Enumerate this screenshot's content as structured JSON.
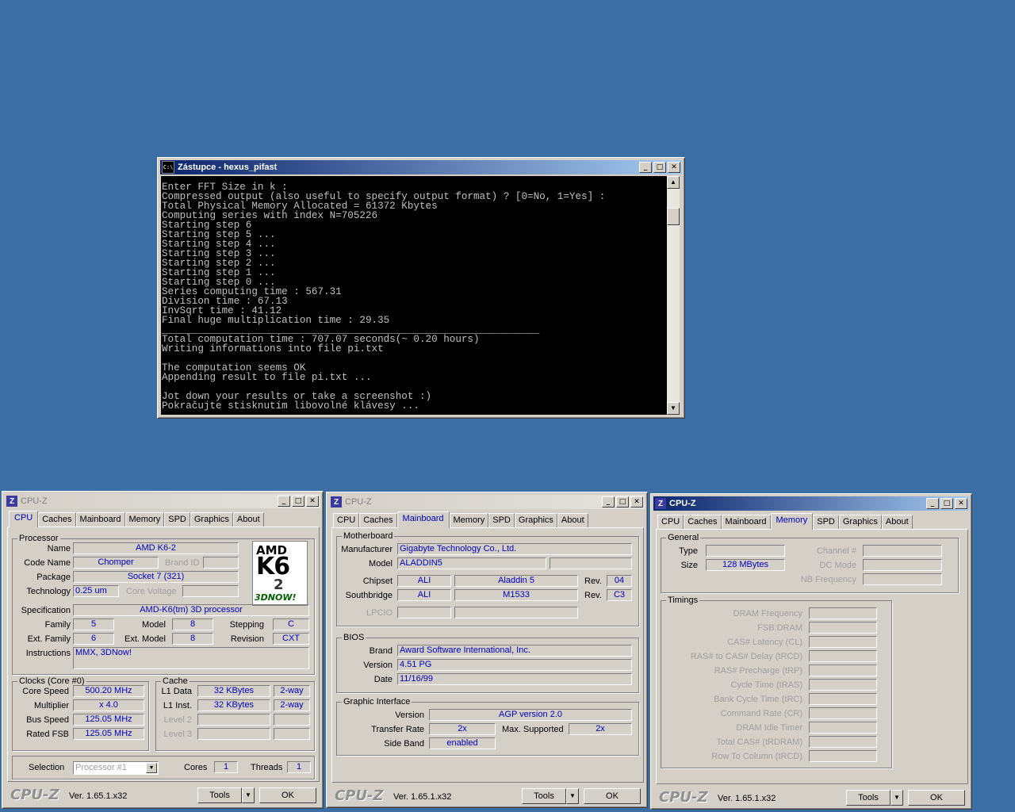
{
  "console_window": {
    "title": "Zástupce - hexus_pifast",
    "icon": "console-icon",
    "lines": [
      "Enter FFT Size in k :",
      "Compressed output (also useful to specify output format) ? [0=No, 1=Yes] :",
      "Total Physical Memory Allocated = 61372 Kbytes",
      "Computing series with index N=705226",
      "Starting step 6",
      "Starting step 5 ...",
      "Starting step 4 ...",
      "Starting step 3 ...",
      "Starting step 2 ...",
      "Starting step 1 ...",
      "Starting step 0 ...",
      "Series computing time : 567.31",
      "Division time : 67.13",
      "InvSqrt time : 41.12",
      "Final huge multiplication time : 29.35",
      "_______________________________________________________________",
      "Total computation time : 707.07 seconds(~ 0.20 hours)",
      "Writing informations into file pi.txt",
      "",
      "The computation seems OK",
      "Appending result to file pi.txt ...",
      "",
      "Jot down your results or take a screenshot :)",
      "Pokračujte stisknutím libovolné klávesy ..."
    ]
  },
  "cpuz_common": {
    "title": "CPU-Z",
    "icon": "cpuz-icon",
    "tabs": [
      "CPU",
      "Caches",
      "Mainboard",
      "Memory",
      "SPD",
      "Graphics",
      "About"
    ],
    "brand": "CPU-Z",
    "version": "Ver. 1.65.1.x32",
    "tools_label": "Tools",
    "ok_label": "OK"
  },
  "cpu_tab": {
    "selected_tab": "CPU",
    "processor": {
      "group": "Processor",
      "name_label": "Name",
      "name": "AMD K6-2",
      "codename_label": "Code Name",
      "codename": "Chomper",
      "brandid_label": "Brand ID",
      "brandid": "",
      "package_label": "Package",
      "package": "Socket 7 (321)",
      "technology_label": "Technology",
      "technology": "0.25 um",
      "corevoltage_label": "Core Voltage",
      "corevoltage": "",
      "spec_label": "Specification",
      "spec": "AMD-K6(tm) 3D processor",
      "family_label": "Family",
      "family": "5",
      "model_label": "Model",
      "model": "8",
      "stepping_label": "Stepping",
      "stepping": "C",
      "extfamily_label": "Ext. Family",
      "extfamily": "6",
      "extmodel_label": "Ext. Model",
      "extmodel": "8",
      "revision_label": "Revision",
      "revision": "CXT",
      "instructions_label": "Instructions",
      "instructions": "MMX, 3DNow!",
      "logo": {
        "line1": "AMD",
        "line2": "K6",
        "line3": "2",
        "line4": "3DNOW!"
      }
    },
    "clocks": {
      "group": "Clocks (Core #0)",
      "corespeed_label": "Core Speed",
      "corespeed": "500.20 MHz",
      "multiplier_label": "Multiplier",
      "multiplier": "x 4.0",
      "busspeed_label": "Bus Speed",
      "busspeed": "125.05 MHz",
      "ratedfsb_label": "Rated FSB",
      "ratedfsb": "125.05 MHz"
    },
    "cache": {
      "group": "Cache",
      "l1data_label": "L1 Data",
      "l1data": "32 KBytes",
      "l1data_way": "2-way",
      "l1inst_label": "L1 Inst.",
      "l1inst": "32 KBytes",
      "l1inst_way": "2-way",
      "level2_label": "Level 2",
      "level3_label": "Level 3"
    },
    "selection_label": "Selection",
    "selection": "Processor #1",
    "cores_label": "Cores",
    "cores": "1",
    "threads_label": "Threads",
    "threads": "1"
  },
  "mainboard_tab": {
    "selected_tab": "Mainboard",
    "motherboard": {
      "group": "Motherboard",
      "manufacturer_label": "Manufacturer",
      "manufacturer": "Gigabyte Technology Co., Ltd.",
      "model_label": "Model",
      "model": "ALADDIN5",
      "chipset_label": "Chipset",
      "chipset_vendor": "ALI",
      "chipset_name": "Aladdin 5",
      "chipset_rev_label": "Rev.",
      "chipset_rev": "04",
      "southbridge_label": "Southbridge",
      "sb_vendor": "ALI",
      "sb_name": "M1533",
      "sb_rev_label": "Rev.",
      "sb_rev": "C3",
      "lpcio_label": "LPCIO"
    },
    "bios": {
      "group": "BIOS",
      "brand_label": "Brand",
      "brand": "Award Software International, Inc.",
      "version_label": "Version",
      "version": "4.51 PG",
      "date_label": "Date",
      "date": "11/16/99"
    },
    "graphic": {
      "group": "Graphic Interface",
      "version_label": "Version",
      "version": "AGP version 2.0",
      "transfer_label": "Transfer Rate",
      "transfer": "2x",
      "maxsup_label": "Max. Supported",
      "maxsup": "2x",
      "sideband_label": "Side Band",
      "sideband": "enabled"
    }
  },
  "memory_tab": {
    "selected_tab": "Memory",
    "general": {
      "group": "General",
      "type_label": "Type",
      "type": "",
      "size_label": "Size",
      "size": "128 MBytes",
      "channel_label": "Channel #",
      "dcmode_label": "DC Mode",
      "nbfreq_label": "NB Frequency"
    },
    "timings": {
      "group": "Timings",
      "labels": [
        "DRAM Frequency",
        "FSB:DRAM",
        "CAS# Latency (CL)",
        "RAS# to CAS# Delay (tRCD)",
        "RAS# Precharge (tRP)",
        "Cycle Time (tRAS)",
        "Bank Cycle Time (tRC)",
        "Command Rate (CR)",
        "DRAM Idle Timer",
        "Total CAS# (tRDRAM)",
        "Row To Column (tRCD)"
      ]
    }
  }
}
